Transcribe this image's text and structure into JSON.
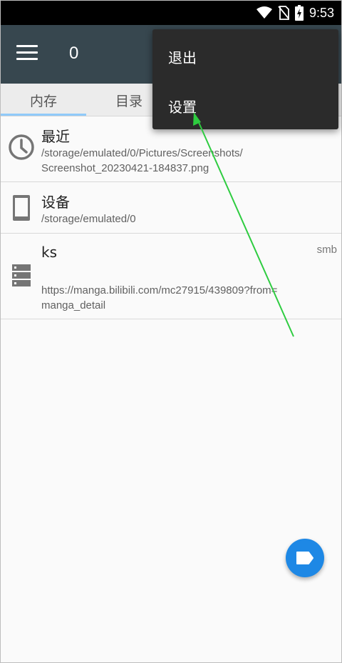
{
  "status_bar": {
    "time": "9:53",
    "icons": [
      "wifi-icon",
      "no-sim-icon",
      "battery-charging-icon"
    ]
  },
  "toolbar": {
    "menu_icon": "hamburger-icon",
    "title": "0"
  },
  "tabs": [
    {
      "label": "内存",
      "active": true
    },
    {
      "label": "目录",
      "active": false
    }
  ],
  "list": {
    "items": [
      {
        "icon": "clock-icon",
        "title": "最近",
        "subtitle_line1": "/storage/emulated/0/Pictures/Screenshots/",
        "subtitle_line2": "Screenshot_20230421-184837.png"
      },
      {
        "icon": "phone-device-icon",
        "title": "设备",
        "subtitle_line1": "/storage/emulated/0"
      },
      {
        "icon": "server-icon",
        "title": "ks",
        "tag": "smb",
        "subtitle_line1": "https://manga.bilibili.com/mc27915/439809?from=",
        "subtitle_line2": "manga_detail"
      }
    ]
  },
  "overflow_menu": {
    "items": [
      {
        "label": "退出"
      },
      {
        "label": "设置"
      }
    ]
  },
  "fab": {
    "icon": "label-tag-icon"
  },
  "colors": {
    "toolbar": "#37474f",
    "menu_bg": "#2b2b2b",
    "fab": "#1e88e5",
    "tab_indicator": "#90caf9",
    "annotation_arrow": "#2ecc40"
  }
}
